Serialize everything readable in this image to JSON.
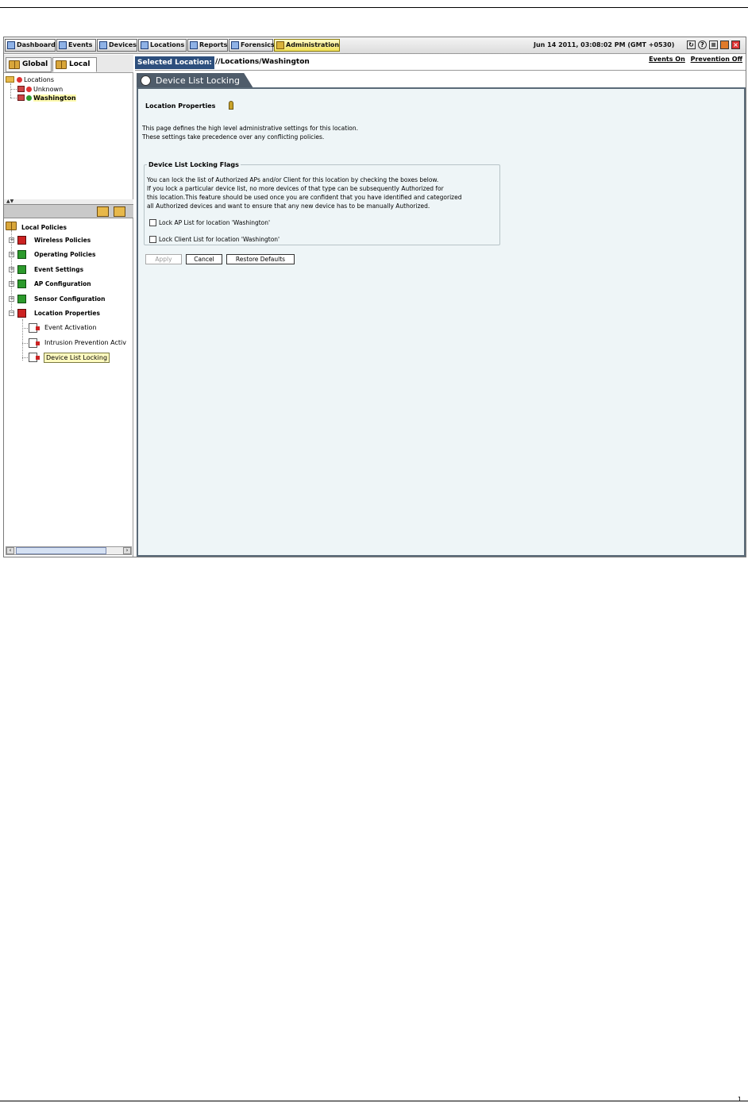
{
  "toolbar": {
    "nav": [
      {
        "label": "Dashboard",
        "icon": "dashboard-icon"
      },
      {
        "label": "Events",
        "icon": "events-icon"
      },
      {
        "label": "Devices",
        "icon": "devices-icon"
      },
      {
        "label": "Locations",
        "icon": "locations-icon"
      },
      {
        "label": "Reports",
        "icon": "reports-icon"
      },
      {
        "label": "Forensics",
        "icon": "forensics-icon"
      },
      {
        "label": "Administration",
        "icon": "administration-icon"
      }
    ],
    "active": "Administration",
    "datetime": "Jun 14 2011, 03:08:02 PM (GMT +0530)",
    "icons": [
      "refresh-icon",
      "help-icon",
      "list-icon",
      "shield-icon",
      "exit-icon"
    ]
  },
  "left_tabs": {
    "global_label": "Global",
    "local_label": "Local"
  },
  "location_tree": {
    "root": "Locations",
    "children": [
      "Unknown",
      "Washington"
    ]
  },
  "policy_tree": {
    "root": "Local Policies",
    "groups": [
      {
        "label": "Wireless Policies",
        "status": "red"
      },
      {
        "label": "Operating Policies",
        "status": "green"
      },
      {
        "label": "Event Settings",
        "status": "green"
      },
      {
        "label": "AP Configuration",
        "status": "green"
      },
      {
        "label": "Sensor Configuration",
        "status": "green"
      },
      {
        "label": "Location Properties",
        "status": "red"
      }
    ],
    "children": [
      "Event Activation",
      "Intrusion Prevention Activ",
      "Device List Locking"
    ]
  },
  "selected_location": {
    "label": "Selected Location:",
    "path": "//Locations/Washington",
    "links": [
      "Events On",
      "Prevention Off"
    ]
  },
  "page_tab": {
    "title": "Device List Locking"
  },
  "content": {
    "heading": "Location Properties",
    "desc_lines": [
      "This page defines the high level administrative settings for this location.",
      "These settings take precedence over any conflicting policies."
    ],
    "flags_legend": "Device List Locking Flags",
    "flags_lines": [
      "You can lock the list of Authorized APs and/or Client for this location by checking the boxes below.",
      "If you lock a particular device list, no more devices of that type can be subsequently Authorized for",
      "this location.This feature should be used once you are confident that you have identified and categorized",
      "all Authorized devices and want to ensure that any new device has to be manually Authorized."
    ],
    "checkboxes": [
      {
        "label": "Lock AP List for location 'Washington'",
        "checked": false
      },
      {
        "label": "Lock Client List for location 'Washington'",
        "checked": false
      }
    ],
    "buttons": {
      "apply": "Apply",
      "cancel": "Cancel",
      "restore": "Restore Defaults"
    }
  },
  "footer": {
    "page_number": "1"
  },
  "colors": {
    "content_bg": "#eef5f7",
    "tab_bg": "#4f5c6a",
    "active_nav": "#f2e25a",
    "selected_label_bg": "#2d4f7d"
  }
}
